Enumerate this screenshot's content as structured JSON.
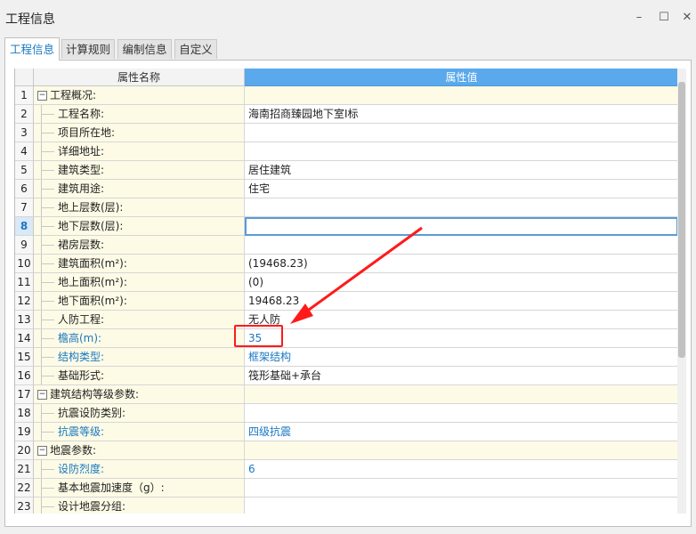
{
  "window": {
    "title": "工程信息",
    "minimize_glyph": "–",
    "maximize_glyph": "☐",
    "close_glyph": "✕"
  },
  "tabs": [
    {
      "label": "工程信息",
      "active": true
    },
    {
      "label": "计算规则",
      "active": false
    },
    {
      "label": "编制信息",
      "active": false
    },
    {
      "label": "自定义",
      "active": false
    }
  ],
  "grid": {
    "header": {
      "name": "属性名称",
      "value": "属性值"
    },
    "rows": [
      {
        "num": "1",
        "name": "工程概况:",
        "value": "",
        "group": true,
        "expander": "−"
      },
      {
        "num": "2",
        "name": "工程名称:",
        "value": "海南招商臻园地下室I标"
      },
      {
        "num": "3",
        "name": "项目所在地:",
        "value": ""
      },
      {
        "num": "4",
        "name": "详细地址:",
        "value": ""
      },
      {
        "num": "5",
        "name": "建筑类型:",
        "value": "居住建筑"
      },
      {
        "num": "6",
        "name": "建筑用途:",
        "value": "住宅"
      },
      {
        "num": "7",
        "name": "地上层数(层):",
        "value": ""
      },
      {
        "num": "8",
        "name": "地下层数(层):",
        "value": "",
        "selected": true
      },
      {
        "num": "9",
        "name": "裙房层数:",
        "value": ""
      },
      {
        "num": "10",
        "name": "建筑面积(m²):",
        "value": "(19468.23)"
      },
      {
        "num": "11",
        "name": "地上面积(m²):",
        "value": "(0)"
      },
      {
        "num": "12",
        "name": "地下面积(m²):",
        "value": "19468.23"
      },
      {
        "num": "13",
        "name": "人防工程:",
        "value": "无人防"
      },
      {
        "num": "14",
        "name": "檐高(m):",
        "value": "35",
        "blue": true
      },
      {
        "num": "15",
        "name": "结构类型:",
        "value": "框架结构",
        "blue": true
      },
      {
        "num": "16",
        "name": "基础形式:",
        "value": "筏形基础+承台"
      },
      {
        "num": "17",
        "name": "建筑结构等级参数:",
        "value": "",
        "group": true,
        "expander": "−"
      },
      {
        "num": "18",
        "name": "抗震设防类别:",
        "value": ""
      },
      {
        "num": "19",
        "name": "抗震等级:",
        "value": "四级抗震",
        "blue": true
      },
      {
        "num": "20",
        "name": "地震参数:",
        "value": "",
        "group": true,
        "expander": "−"
      },
      {
        "num": "21",
        "name": "设防烈度:",
        "value": "6",
        "blue": true
      },
      {
        "num": "22",
        "name": "基本地震加速度（g）:",
        "value": ""
      },
      {
        "num": "23",
        "name": "设计地震分组:",
        "value": ""
      }
    ]
  },
  "colors": {
    "accent": "#1a78c2",
    "header_value_bg": "#5aa9ec",
    "annotation": "#ff1a1a"
  }
}
